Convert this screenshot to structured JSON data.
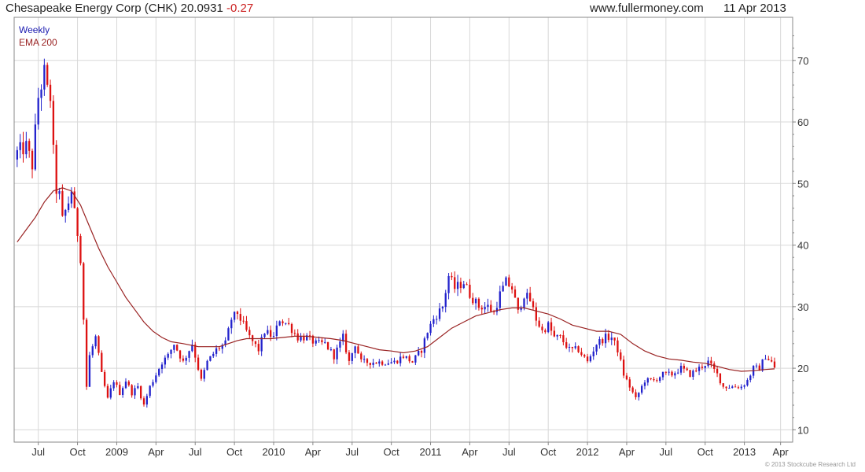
{
  "header": {
    "title": "Chesapeake Energy Corp (CHK) 20.0931",
    "change": "-0.27",
    "site": "www.fullermoney.com",
    "date": "11 Apr 2013"
  },
  "footer": {
    "copyright": "© 2013 Stockcube Research Ltd"
  },
  "colors": {
    "up": "#2222cc",
    "down": "#dd1111",
    "ema": "#992222",
    "grid": "#d8d8d8",
    "frame": "#888888"
  },
  "chart_data": {
    "type": "candlestick",
    "legend": [
      "Weekly",
      "EMA 200"
    ],
    "ylim": [
      8,
      77
    ],
    "yticks": [
      10,
      20,
      30,
      40,
      50,
      60,
      70
    ],
    "xlim": [
      0,
      251
    ],
    "xticks": [
      {
        "w": 7,
        "label": "Jul"
      },
      {
        "w": 20,
        "label": "Oct"
      },
      {
        "w": 33,
        "label": "2009"
      },
      {
        "w": 46,
        "label": "Apr"
      },
      {
        "w": 59,
        "label": "Jul"
      },
      {
        "w": 72,
        "label": "Oct"
      },
      {
        "w": 85,
        "label": "2010"
      },
      {
        "w": 98,
        "label": "Apr"
      },
      {
        "w": 111,
        "label": "Jul"
      },
      {
        "w": 124,
        "label": "Oct"
      },
      {
        "w": 137,
        "label": "2011"
      },
      {
        "w": 150,
        "label": "Apr"
      },
      {
        "w": 163,
        "label": "Jul"
      },
      {
        "w": 176,
        "label": "Oct"
      },
      {
        "w": 189,
        "label": "2012"
      },
      {
        "w": 202,
        "label": "Apr"
      },
      {
        "w": 215,
        "label": "Jul"
      },
      {
        "w": 228,
        "label": "Oct"
      },
      {
        "w": 241,
        "label": "2013"
      },
      {
        "w": 253,
        "label": "Apr"
      }
    ],
    "close_anchors": [
      [
        0,
        55
      ],
      [
        3,
        56
      ],
      [
        5,
        53
      ],
      [
        7,
        64
      ],
      [
        9,
        68
      ],
      [
        10,
        65
      ],
      [
        11,
        64
      ],
      [
        12,
        55
      ],
      [
        13,
        49
      ],
      [
        14,
        48
      ],
      [
        15,
        44
      ],
      [
        17,
        47
      ],
      [
        18,
        49
      ],
      [
        19,
        45
      ],
      [
        20,
        42
      ],
      [
        21,
        38
      ],
      [
        22,
        28
      ],
      [
        23,
        17
      ],
      [
        24,
        22
      ],
      [
        26,
        25
      ],
      [
        28,
        19
      ],
      [
        30,
        15
      ],
      [
        32,
        18
      ],
      [
        34,
        16
      ],
      [
        36,
        18
      ],
      [
        38,
        16
      ],
      [
        40,
        17
      ],
      [
        42,
        14
      ],
      [
        44,
        17
      ],
      [
        46,
        19
      ],
      [
        48,
        21
      ],
      [
        50,
        22
      ],
      [
        52,
        24
      ],
      [
        55,
        21
      ],
      [
        58,
        24
      ],
      [
        61,
        18
      ],
      [
        63,
        21
      ],
      [
        66,
        23
      ],
      [
        69,
        24
      ],
      [
        71,
        28
      ],
      [
        73,
        29
      ],
      [
        75,
        27
      ],
      [
        77,
        25
      ],
      [
        80,
        23
      ],
      [
        82,
        26
      ],
      [
        85,
        25
      ],
      [
        87,
        28
      ],
      [
        90,
        27
      ],
      [
        93,
        25
      ],
      [
        96,
        25
      ],
      [
        99,
        24
      ],
      [
        102,
        24
      ],
      [
        105,
        22
      ],
      [
        108,
        25
      ],
      [
        110,
        21
      ],
      [
        112,
        24
      ],
      [
        114,
        21
      ],
      [
        117,
        21
      ],
      [
        121,
        21
      ],
      [
        125,
        21
      ],
      [
        128,
        22
      ],
      [
        131,
        21
      ],
      [
        134,
        23
      ],
      [
        136,
        26
      ],
      [
        138,
        28
      ],
      [
        141,
        30
      ],
      [
        143,
        35
      ],
      [
        145,
        33
      ],
      [
        148,
        34
      ],
      [
        150,
        32
      ],
      [
        153,
        30
      ],
      [
        156,
        30
      ],
      [
        158,
        29
      ],
      [
        160,
        32
      ],
      [
        162,
        34
      ],
      [
        164,
        33
      ],
      [
        166,
        29
      ],
      [
        168,
        32
      ],
      [
        170,
        31
      ],
      [
        172,
        28
      ],
      [
        174,
        26
      ],
      [
        176,
        27
      ],
      [
        178,
        25
      ],
      [
        180,
        25
      ],
      [
        183,
        23
      ],
      [
        186,
        23
      ],
      [
        189,
        21
      ],
      [
        192,
        24
      ],
      [
        195,
        25
      ],
      [
        197,
        25
      ],
      [
        199,
        23
      ],
      [
        201,
        19
      ],
      [
        203,
        17
      ],
      [
        205,
        15
      ],
      [
        208,
        18
      ],
      [
        211,
        18
      ],
      [
        214,
        19
      ],
      [
        217,
        19
      ],
      [
        220,
        20
      ],
      [
        223,
        19
      ],
      [
        226,
        20
      ],
      [
        229,
        21
      ],
      [
        232,
        19
      ],
      [
        234,
        17
      ],
      [
        236,
        17
      ],
      [
        240,
        17
      ],
      [
        242,
        18
      ],
      [
        244,
        20
      ],
      [
        246,
        20
      ],
      [
        248,
        22
      ],
      [
        250,
        21
      ],
      [
        251,
        20.1
      ]
    ],
    "ema_200": [
      [
        0,
        40.5
      ],
      [
        3,
        42.5
      ],
      [
        6,
        44.5
      ],
      [
        9,
        47
      ],
      [
        12,
        48.8
      ],
      [
        15,
        49.3
      ],
      [
        18,
        48.8
      ],
      [
        21,
        46.5
      ],
      [
        24,
        43
      ],
      [
        27,
        39.5
      ],
      [
        30,
        36.5
      ],
      [
        33,
        34
      ],
      [
        36,
        31.5
      ],
      [
        39,
        29.5
      ],
      [
        42,
        27.5
      ],
      [
        45,
        26
      ],
      [
        48,
        25
      ],
      [
        51,
        24.3
      ],
      [
        55,
        24
      ],
      [
        60,
        23.5
      ],
      [
        63,
        23.5
      ],
      [
        67,
        23.5
      ],
      [
        70,
        24
      ],
      [
        73,
        24.5
      ],
      [
        76,
        24.8
      ],
      [
        80,
        24.8
      ],
      [
        84,
        24.8
      ],
      [
        88,
        25
      ],
      [
        92,
        25.2
      ],
      [
        96,
        25.2
      ],
      [
        100,
        25
      ],
      [
        104,
        24.8
      ],
      [
        108,
        24.5
      ],
      [
        112,
        24
      ],
      [
        116,
        23.5
      ],
      [
        120,
        23
      ],
      [
        124,
        22.8
      ],
      [
        128,
        22.5
      ],
      [
        132,
        22.8
      ],
      [
        136,
        23.5
      ],
      [
        140,
        25
      ],
      [
        144,
        26.5
      ],
      [
        148,
        27.5
      ],
      [
        152,
        28.5
      ],
      [
        156,
        29
      ],
      [
        160,
        29.5
      ],
      [
        164,
        29.8
      ],
      [
        168,
        29.8
      ],
      [
        172,
        29.3
      ],
      [
        176,
        28.8
      ],
      [
        180,
        28
      ],
      [
        184,
        27
      ],
      [
        188,
        26.5
      ],
      [
        192,
        26
      ],
      [
        196,
        26
      ],
      [
        200,
        25.5
      ],
      [
        204,
        24
      ],
      [
        208,
        22.8
      ],
      [
        212,
        22
      ],
      [
        216,
        21.5
      ],
      [
        220,
        21.3
      ],
      [
        224,
        21
      ],
      [
        228,
        20.8
      ],
      [
        232,
        20.3
      ],
      [
        236,
        19.8
      ],
      [
        240,
        19.5
      ],
      [
        244,
        19.6
      ],
      [
        248,
        19.8
      ],
      [
        251,
        19.9
      ]
    ]
  }
}
